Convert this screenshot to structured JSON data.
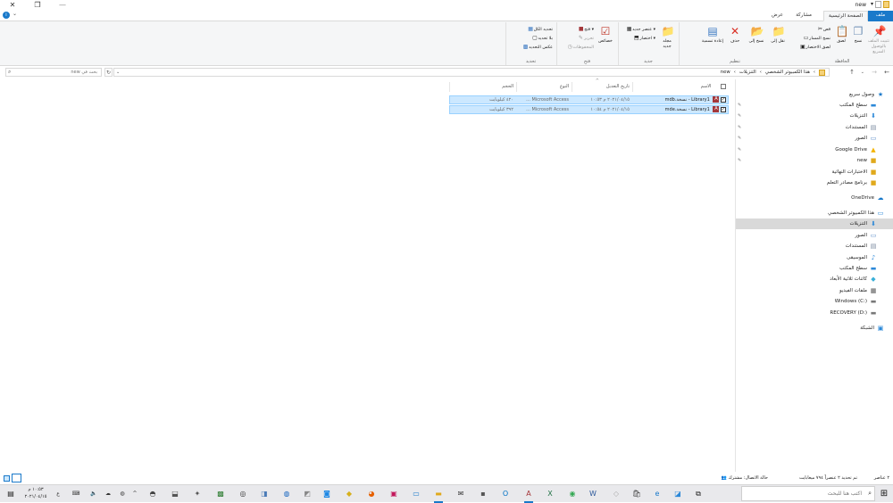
{
  "window": {
    "title": "new",
    "close_glyph": "✕",
    "maximize_glyph": "❐",
    "minimize_glyph": "—",
    "help_glyph": "i",
    "expand_glyph": "⌄"
  },
  "tabs": {
    "file": "ملف",
    "home": "الصفحة الرئيسية",
    "share": "مشاركة",
    "view": "عرض"
  },
  "ribbon": {
    "clipboard": {
      "caption": "الحافظة",
      "pin_quick_access": "تثبيت الملف بالوصول السريع",
      "copy": "نسخ",
      "paste": "لصق",
      "cut": "قص",
      "copy_path": "نسخ المسار",
      "paste_shortcut": "لصق الاختصار"
    },
    "organize": {
      "caption": "تنظيم",
      "move_to": "نقل إلى",
      "copy_to": "نسخ إلى",
      "delete": "حذف",
      "rename": "إعادة تسمية"
    },
    "new": {
      "caption": "جديد",
      "new_folder": "مجلد جديد",
      "new_item": "عنصر جديد",
      "easy_access": "اختصار"
    },
    "open": {
      "caption": "فتح",
      "properties": "خصائص",
      "open": "فتح",
      "edit": "تحرير",
      "history": "المحفوظات"
    },
    "select": {
      "caption": "تحديد",
      "select_all": "تحديد الكل",
      "select_none": "بلا تحديد",
      "invert_selection": "عكس التحديد"
    }
  },
  "address": {
    "back_glyph": "←",
    "forward_glyph": "→",
    "recent_glyph": "⌄",
    "up_glyph": "↑",
    "breadcrumbs": [
      "هذا الكمبيوتر الشخصي",
      "التنزيلات",
      "new"
    ],
    "separator": "›",
    "dropdown_glyph": "⌄",
    "refresh_glyph": "↻",
    "search_placeholder": "بحث في new",
    "search_glyph": "⌕"
  },
  "nav": {
    "quick_access": "وصول سريع",
    "quick_items": [
      {
        "label": "سطح المكتب",
        "icon": "desktop-icon",
        "pinned": true
      },
      {
        "label": "التنزيلات",
        "icon": "downloads-icon",
        "pinned": true
      },
      {
        "label": "المستندات",
        "icon": "documents-icon",
        "pinned": true
      },
      {
        "label": "الصور",
        "icon": "pictures-icon",
        "pinned": true
      },
      {
        "label": "Google Drive",
        "icon": "google-drive-icon",
        "pinned": true
      },
      {
        "label": "new",
        "icon": "folder-icon",
        "pinned": true
      },
      {
        "label": "الاختبارات النهائية",
        "icon": "folder-icon",
        "pinned": false
      },
      {
        "label": "برنامج مصادر التعلم",
        "icon": "folder-icon",
        "pinned": false
      }
    ],
    "onedrive": "OneDrive",
    "this_pc": "هذا الكمبيوتر الشخصي",
    "pc_items": [
      {
        "label": "التنزيلات",
        "icon": "downloads-icon",
        "selected": true
      },
      {
        "label": "الصور",
        "icon": "pictures-icon",
        "selected": false
      },
      {
        "label": "المستندات",
        "icon": "documents-icon",
        "selected": false
      },
      {
        "label": "الموسيقى",
        "icon": "music-icon",
        "selected": false
      },
      {
        "label": "سطح المكتب",
        "icon": "desktop-icon",
        "selected": false
      },
      {
        "label": "كائنات ثلاثية الأبعاد",
        "icon": "3d-objects-icon",
        "selected": false
      },
      {
        "label": "ملفات الفيديو",
        "icon": "videos-icon",
        "selected": false
      },
      {
        "label": "Windows (C:)",
        "icon": "drive-icon",
        "selected": false
      },
      {
        "label": "RECOVERY (D:)",
        "icon": "drive-icon",
        "selected": false
      }
    ],
    "network": "الشبكة"
  },
  "files": {
    "columns": {
      "name": "الاسم",
      "modified": "تاريخ التعديل",
      "type": "النوع",
      "size": "الحجم"
    },
    "sort_glyph": "^",
    "rows": [
      {
        "name": "Library1 - نسخة.mdb",
        "modified": "٢٠٢١/٠٤/١٥ م ١٠:٥٣",
        "type": "Microsoft Access ...",
        "size": "٤٢٠ كيلوبايت"
      },
      {
        "name": "Library1 - نسخة.mde",
        "modified": "٢٠٢١/٠٤/١٥ م ١٠:٥٤",
        "type": "Microsoft Access ...",
        "size": "٣٩٢ كيلوبايت"
      }
    ]
  },
  "status": {
    "count": "٢ عناصر",
    "selected": "تم تحديد ٢ عنصراً ٧٩٤ ميغابايت",
    "sync": "حالة الاتصال: مشترك"
  },
  "taskbar": {
    "search_placeholder": "اكتب هنا للبحث",
    "time": "١٠:٥٣ م",
    "date": "٢٠٢١/٠٤/١٥",
    "lang": "ع"
  },
  "colors": {
    "accent": "#1979ca",
    "selection": "#cce8ff",
    "selection_border": "#99d1ff",
    "nav_selected": "#d9d9d9",
    "folder": "#f5d27a",
    "access": "#a4373a"
  }
}
